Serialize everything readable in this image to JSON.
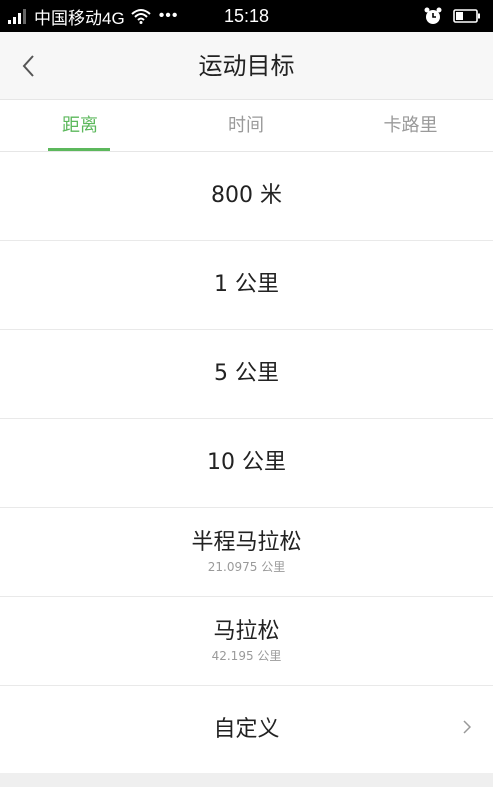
{
  "status_bar": {
    "carrier": "中国移动4G",
    "dots": "•••",
    "time": "15:18"
  },
  "nav": {
    "title": "运动目标"
  },
  "tabs": [
    {
      "label": "距离",
      "active": true
    },
    {
      "label": "时间",
      "active": false
    },
    {
      "label": "卡路里",
      "active": false
    }
  ],
  "options": [
    {
      "label": "800 米"
    },
    {
      "label": "1 公里"
    },
    {
      "label": "5 公里"
    },
    {
      "label": "10 公里"
    },
    {
      "label": "半程马拉松",
      "sub": "21.0975 公里"
    },
    {
      "label": "马拉松",
      "sub": "42.195 公里"
    },
    {
      "label": "自定义"
    }
  ],
  "colors": {
    "accent": "#5cb85c",
    "text": "#222222",
    "muted": "#9a9a9a",
    "divider": "#e9e9e9"
  }
}
